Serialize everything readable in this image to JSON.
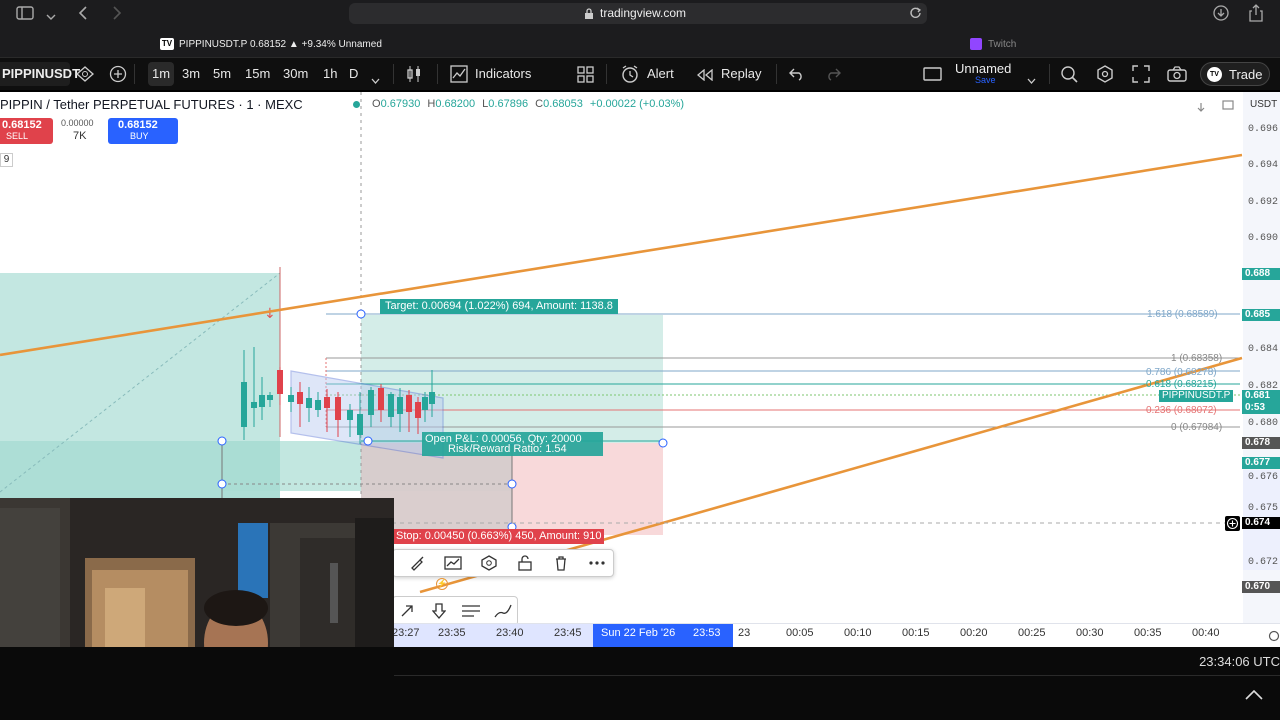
{
  "browser": {
    "url": "tradingview.com",
    "icons": [
      "sidebar-icon",
      "chevron-down-icon",
      "back-icon",
      "forward-icon",
      "lock-icon",
      "reload-icon",
      "download-icon",
      "share-icon"
    ]
  },
  "tabs": [
    {
      "label": "PIPPINUSDT.P 0.68152 ▲ +9.34% Unnamed",
      "active": true
    },
    {
      "label": "Twitch",
      "active": false
    }
  ],
  "toolbar": {
    "symbol": "PIPPINUSDT",
    "intervals": [
      "1m",
      "3m",
      "5m",
      "15m",
      "30m",
      "1h",
      "D"
    ],
    "active_interval": "1m",
    "indicators_label": "Indicators",
    "alert_label": "Alert",
    "replay_label": "Replay",
    "layout_name": "Unnamed",
    "layout_sub": "Save",
    "trade_label": "Trade"
  },
  "legend": {
    "title": "PIPPIN / Tether PERPETUAL FUTURES · 1 · MEXC",
    "o_label": "O",
    "o": "0.67930",
    "h_label": "H",
    "h": "0.68200",
    "l_label": "L",
    "l": "0.67896",
    "c_label": "C",
    "c": "0.68053",
    "change": "+0.00022 (+0.03%)",
    "currency": "USDT"
  },
  "order_panel": {
    "sell_price": "0.68152",
    "sell_label": "SELL",
    "spread": "0.00000",
    "qty": "7K",
    "buy_price": "0.68152",
    "buy_label": "BUY",
    "badge": "9"
  },
  "price_axis": {
    "labels": [
      "0.696",
      "0.694",
      "0.692",
      "0.690",
      "0.684",
      "0.682",
      "0.680",
      "0.678",
      "0.677",
      "0.676",
      "0.675",
      "0.674",
      "0.672",
      "0.670"
    ],
    "tags": [
      {
        "text": "0.688",
        "color": "#26a69a"
      },
      {
        "text": "0.685",
        "color": "#26a69a"
      },
      {
        "text": "0.681",
        "color": "#26a69a"
      },
      {
        "text": "0:53",
        "color": "#26a69a"
      },
      {
        "text": "0.678",
        "color": "#555"
      },
      {
        "text": "0.677",
        "color": "#26a69a"
      },
      {
        "text": "0.674",
        "color": "#000"
      },
      {
        "text": "0.670",
        "color": "#555"
      }
    ],
    "symbol_tag": "PIPPINUSDT.P"
  },
  "position_tool": {
    "target": "Target: 0.00694 (1.022%) 694, Amount: 1138.8",
    "open_pnl": "Open P&L: 0.00056, Qty: 20000",
    "rr": "Risk/Reward Ratio: 1.54",
    "stop": "Stop: 0.00450 (0.663%) 450, Amount: 910"
  },
  "fib_levels": [
    {
      "label": "1.618 (0.68589)",
      "color": "#7fa7c9"
    },
    {
      "label": "1 (0.68358)",
      "color": "#888"
    },
    {
      "label": "0.786 (0.68278)",
      "color": "#7fa7c9"
    },
    {
      "label": "0.618 (0.68215)",
      "color": "#26a69a"
    },
    {
      "label": "0.236 (0.68072)",
      "color": "#e57373"
    },
    {
      "label": "0 (0.67984)",
      "color": "#888"
    }
  ],
  "time_axis": {
    "labels": [
      "23:27",
      "23:35",
      "23:40",
      "23:45",
      "23",
      "00:05",
      "00:10",
      "00:15",
      "00:20",
      "00:25",
      "00:30",
      "00:35",
      "00:40"
    ],
    "highlight": "Sun 22 Feb '26",
    "highlight_time": "23:53"
  },
  "clock": "23:34:06 UTC",
  "drawing_toolbar_icons": [
    "brush-icon",
    "chart-settings-icon",
    "settings-icon",
    "unlock-icon",
    "trash-icon",
    "more-icon"
  ],
  "drawing_toolbar2_icons": [
    "arrow-icon",
    "down-arrow-icon",
    "lines-icon",
    "brush-alt-icon"
  ]
}
